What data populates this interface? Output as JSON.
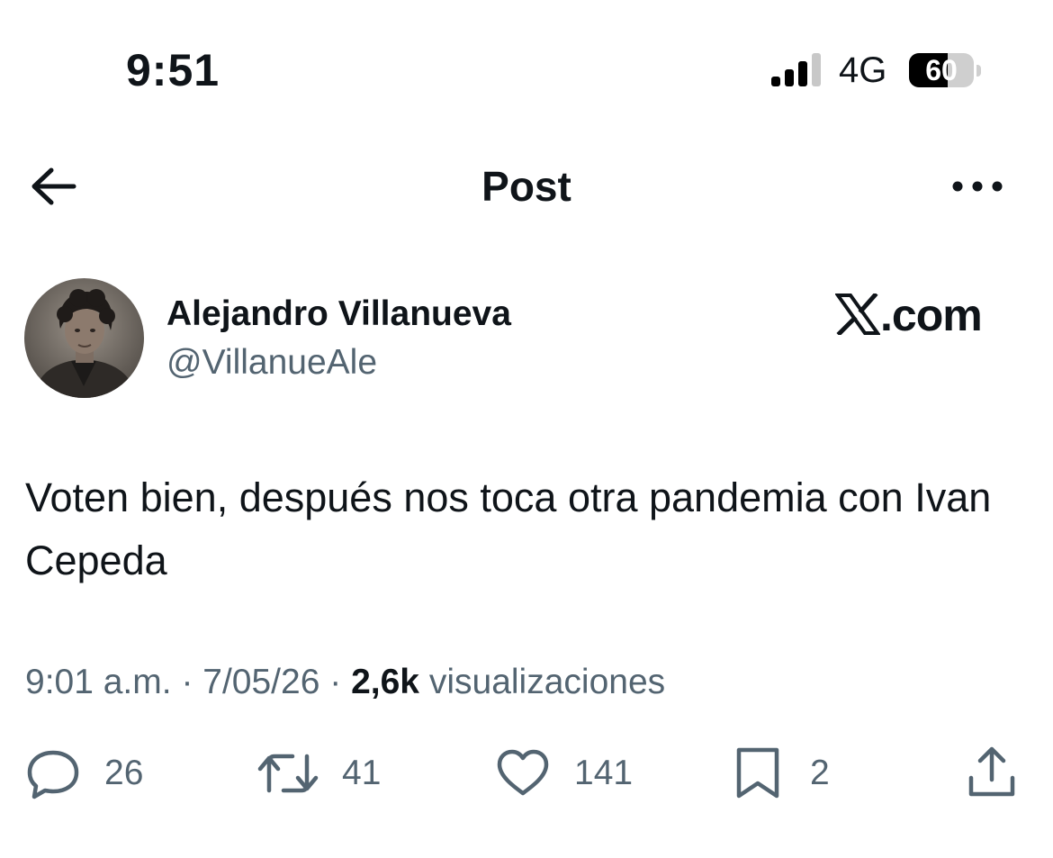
{
  "status_bar": {
    "time": "9:51",
    "network": "4G",
    "battery_level": "60",
    "battery_fraction": 0.6,
    "signal_bars_active": 3,
    "signal_bars_total": 4,
    "icons": [
      "signal-icon",
      "battery-icon"
    ]
  },
  "header": {
    "title": "Post",
    "back_icon": "arrow-left-icon",
    "more_icon": "more-horizontal-icon"
  },
  "author": {
    "name": "Alejandro Villanueva",
    "handle": "@VillanueAle",
    "avatar": "avatar-photo"
  },
  "watermark": {
    "text": ".com",
    "logo": "x-logo"
  },
  "tweet": {
    "text": "Voten bien, después nos toca otra pandemia con Ivan Cepeda"
  },
  "meta": {
    "time": "9:01 a.m.",
    "separator": "·",
    "date": "7/05/26",
    "views_count": "2,6k",
    "views_label": "visualizaciones"
  },
  "actions": {
    "reply": {
      "icon": "reply-icon",
      "count": "26"
    },
    "repost": {
      "icon": "repost-icon",
      "count": "41"
    },
    "like": {
      "icon": "heart-icon",
      "count": "141"
    },
    "bookmark": {
      "icon": "bookmark-icon",
      "count": "2"
    },
    "share": {
      "icon": "share-icon"
    }
  },
  "colors": {
    "text_primary": "#0f1419",
    "text_secondary": "#536471",
    "background": "#ffffff"
  }
}
